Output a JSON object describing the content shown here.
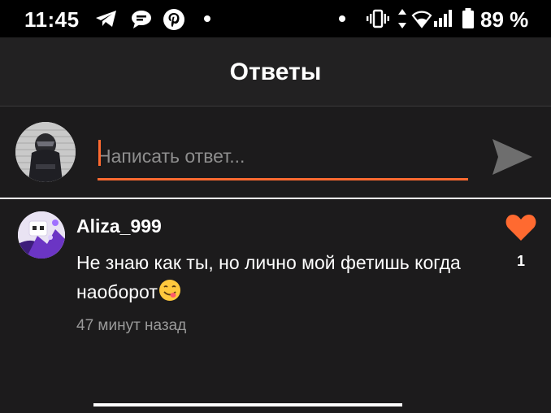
{
  "status_bar": {
    "time": "11:45",
    "battery": "89 %",
    "icons": [
      "telegram-icon",
      "chat-bubble-icon",
      "pinterest-icon",
      "notification-dot-icon",
      "vibrate-icon",
      "data-arrows-icon",
      "wifi-icon",
      "signal-icon",
      "battery-icon"
    ]
  },
  "header": {
    "title": "Ответы"
  },
  "composer": {
    "placeholder": "Написать ответ...",
    "value": "",
    "send_icon": "send-icon"
  },
  "comment": {
    "author": "Aliza_999",
    "text": "Не знаю как ты, но лично мой фетишь когда наоборот",
    "emoji": "face-savoring-food-emoji",
    "time": "47 минут назад",
    "like_count": "1",
    "like_icon": "heart-icon"
  },
  "colors": {
    "background": "#1c1b1c",
    "header_bg": "#222122",
    "status_bar_bg": "#000000",
    "accent": "#ff6a30",
    "secondary_text": "#9a9a9a"
  }
}
